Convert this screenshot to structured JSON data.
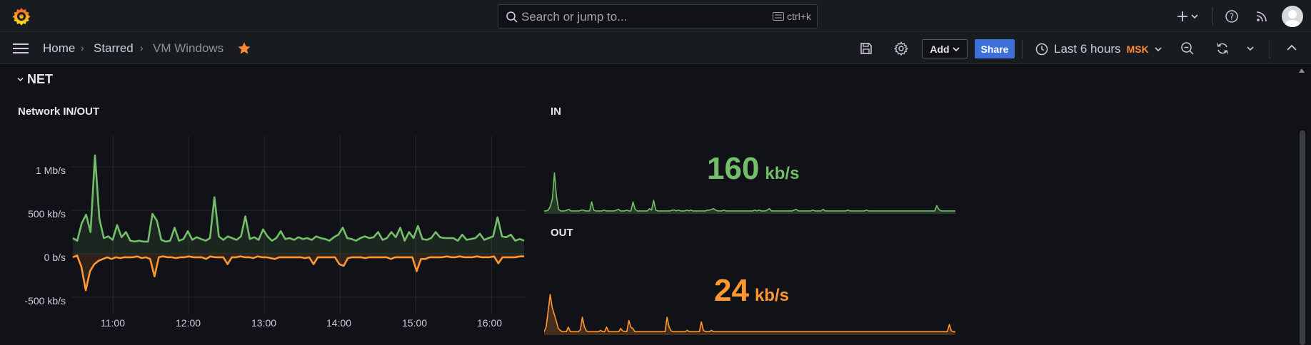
{
  "topbar": {
    "search_placeholder": "Search or jump to...",
    "search_shortcut": "ctrl+k"
  },
  "breadcrumb": {
    "home": "Home",
    "starred": "Starred",
    "current": "VM Windows"
  },
  "toolbar": {
    "add_label": "Add",
    "share_label": "Share",
    "time_range": "Last 6 hours",
    "timezone": "MSK"
  },
  "row": {
    "title": "NET"
  },
  "panels": {
    "network": {
      "title": "Network IN/OUT"
    },
    "in": {
      "title": "IN",
      "value": "160",
      "unit": "kb/s",
      "color": "#73bf69"
    },
    "out": {
      "title": "OUT",
      "value": "24",
      "unit": "kb/s",
      "color": "#ff9830"
    }
  },
  "chart_data": [
    {
      "type": "line",
      "title": "Network IN/OUT",
      "y_tick_labels": [
        "1 Mb/s",
        "500 kb/s",
        "0 b/s",
        "-500 kb/s"
      ],
      "y_tick_values": [
        1000,
        500,
        0,
        -500
      ],
      "x_tick_labels": [
        "11:00",
        "12:00",
        "13:00",
        "14:00",
        "15:00",
        "16:00"
      ],
      "x_tick_hours": [
        11,
        12,
        13,
        14,
        15,
        16
      ],
      "x_range_hours": [
        10.45,
        16.45
      ],
      "ylim": [
        -600,
        1400
      ],
      "grid": true,
      "series": [
        {
          "color": "#73bf69",
          "values": [
            180,
            150,
            350,
            450,
            250,
            1130,
            400,
            180,
            200,
            160,
            330,
            190,
            250,
            150,
            140,
            150,
            140,
            140,
            460,
            380,
            160,
            140,
            150,
            300,
            150,
            170,
            260,
            160,
            190,
            170,
            150,
            180,
            650,
            200,
            160,
            200,
            180,
            160,
            200,
            430,
            170,
            190,
            160,
            280,
            200,
            150,
            180,
            260,
            170,
            180,
            160,
            190,
            170,
            180,
            160,
            200,
            180,
            170,
            150,
            190,
            220,
            300,
            180,
            170,
            150,
            180,
            200,
            180,
            190,
            250,
            160,
            180,
            250,
            190,
            300,
            150,
            250,
            180,
            320,
            170,
            160,
            180,
            250,
            190,
            180,
            180,
            180,
            150,
            220,
            160,
            170,
            180,
            230,
            160,
            180,
            200,
            420,
            200,
            190,
            220,
            150,
            170,
            150
          ]
        },
        {
          "color": "#ff9830",
          "values": [
            -40,
            -20,
            -150,
            -420,
            -200,
            -120,
            -80,
            -60,
            -40,
            -60,
            -40,
            -50,
            -40,
            -40,
            -40,
            -30,
            -50,
            -40,
            -60,
            -260,
            -40,
            -30,
            -40,
            -40,
            -50,
            -40,
            -40,
            -30,
            -40,
            -40,
            -40,
            -60,
            -30,
            -40,
            -40,
            -40,
            -120,
            -40,
            -40,
            -30,
            -40,
            -40,
            -50,
            -30,
            -40,
            -40,
            -50,
            -60,
            -40,
            -40,
            -40,
            -40,
            -40,
            -40,
            -50,
            -40,
            -120,
            -40,
            -40,
            -40,
            -40,
            -40,
            -120,
            -140,
            -50,
            -40,
            -40,
            -40,
            -50,
            -40,
            -40,
            -40,
            -40,
            -40,
            -60,
            -40,
            -40,
            -40,
            -40,
            -40,
            -200,
            -60,
            -60,
            -40,
            -40,
            -40,
            -40,
            -30,
            -40,
            -40,
            -30,
            -40,
            -40,
            -40,
            -30,
            -40,
            -40,
            -40,
            -30,
            -110,
            -40,
            -40,
            -40,
            -40,
            -30,
            -30
          ]
        }
      ]
    },
    {
      "type": "area",
      "title": "IN",
      "color": "#73bf69",
      "values": [
        2,
        2,
        3,
        8,
        18,
        52,
        20,
        4,
        2,
        2,
        2,
        3,
        4,
        2,
        2,
        2,
        2,
        2,
        3,
        3,
        2,
        2,
        2,
        14,
        3,
        2,
        2,
        2,
        2,
        3,
        2,
        2,
        2,
        2,
        2,
        3,
        4,
        2,
        2,
        2,
        3,
        2,
        2,
        14,
        4,
        2,
        2,
        2,
        2,
        2,
        2,
        5,
        3,
        16,
        3,
        2,
        2,
        2,
        2,
        2,
        2,
        2,
        3,
        3,
        2,
        3,
        2,
        2,
        2,
        3,
        2,
        3,
        2,
        2,
        2,
        2,
        2,
        2,
        2,
        3,
        3,
        4,
        5,
        3,
        2,
        2,
        2,
        3,
        2,
        2,
        2,
        2,
        2,
        2,
        2,
        2,
        2,
        2,
        2,
        2,
        2,
        2,
        3,
        2,
        3,
        2,
        2,
        2,
        3,
        5,
        2,
        2,
        2,
        2,
        2,
        2,
        2,
        2,
        2,
        2,
        2,
        3,
        4,
        2,
        2,
        2,
        2,
        2,
        2,
        2,
        3,
        2,
        2,
        2,
        2,
        4,
        2,
        2,
        2,
        2,
        2,
        2,
        2,
        2,
        2,
        2,
        2,
        3,
        2,
        2,
        2,
        2,
        2,
        2,
        2,
        2,
        3,
        2,
        2,
        2,
        2,
        2,
        2,
        2,
        2,
        2,
        2,
        2,
        2,
        2,
        2,
        2,
        2,
        2,
        2,
        2,
        2,
        2,
        2,
        2,
        2,
        2,
        2,
        2,
        2,
        2,
        2,
        2,
        2,
        2,
        9,
        4,
        2,
        2,
        2,
        2,
        2,
        2,
        2,
        2
      ],
      "ylim": [
        0,
        60
      ]
    },
    {
      "type": "area",
      "title": "OUT",
      "color": "#ff9830",
      "values": [
        3,
        10,
        34,
        60,
        40,
        30,
        20,
        8,
        5,
        3,
        3,
        3,
        10,
        3,
        3,
        3,
        3,
        3,
        6,
        25,
        10,
        4,
        3,
        3,
        3,
        3,
        3,
        3,
        5,
        3,
        3,
        10,
        3,
        3,
        3,
        3,
        3,
        3,
        8,
        4,
        3,
        3,
        20,
        10,
        8,
        3,
        3,
        3,
        3,
        3,
        3,
        3,
        3,
        3,
        3,
        3,
        3,
        3,
        3,
        3,
        3,
        25,
        10,
        4,
        3,
        3,
        3,
        3,
        3,
        3,
        3,
        5,
        3,
        3,
        3,
        3,
        3,
        3,
        18,
        5,
        3,
        3,
        3,
        5,
        3,
        3,
        3,
        3,
        3,
        3,
        3,
        3,
        3,
        3,
        3,
        3,
        3,
        3,
        3,
        3,
        3,
        3,
        3,
        3,
        3,
        3,
        3,
        3,
        3,
        3,
        3,
        3,
        3,
        3,
        3,
        3,
        3,
        3,
        3,
        3,
        3,
        3,
        3,
        3,
        3,
        3,
        3,
        3,
        3,
        3,
        3,
        3,
        3,
        3,
        3,
        3,
        3,
        3,
        3,
        3,
        3,
        3,
        3,
        3,
        3,
        3,
        3,
        3,
        3,
        3,
        3,
        3,
        3,
        3,
        3,
        3,
        3,
        3,
        3,
        3,
        3,
        3,
        3,
        3,
        3,
        3,
        3,
        3,
        3,
        3,
        3,
        3,
        3,
        3,
        3,
        3,
        3,
        3,
        3,
        3,
        3,
        3,
        3,
        3,
        3,
        3,
        3,
        3,
        3,
        3,
        3,
        3,
        3,
        3,
        3,
        3,
        3,
        3,
        3,
        3,
        3,
        14,
        4,
        3,
        3
      ],
      "ylim": [
        0,
        70
      ]
    }
  ]
}
